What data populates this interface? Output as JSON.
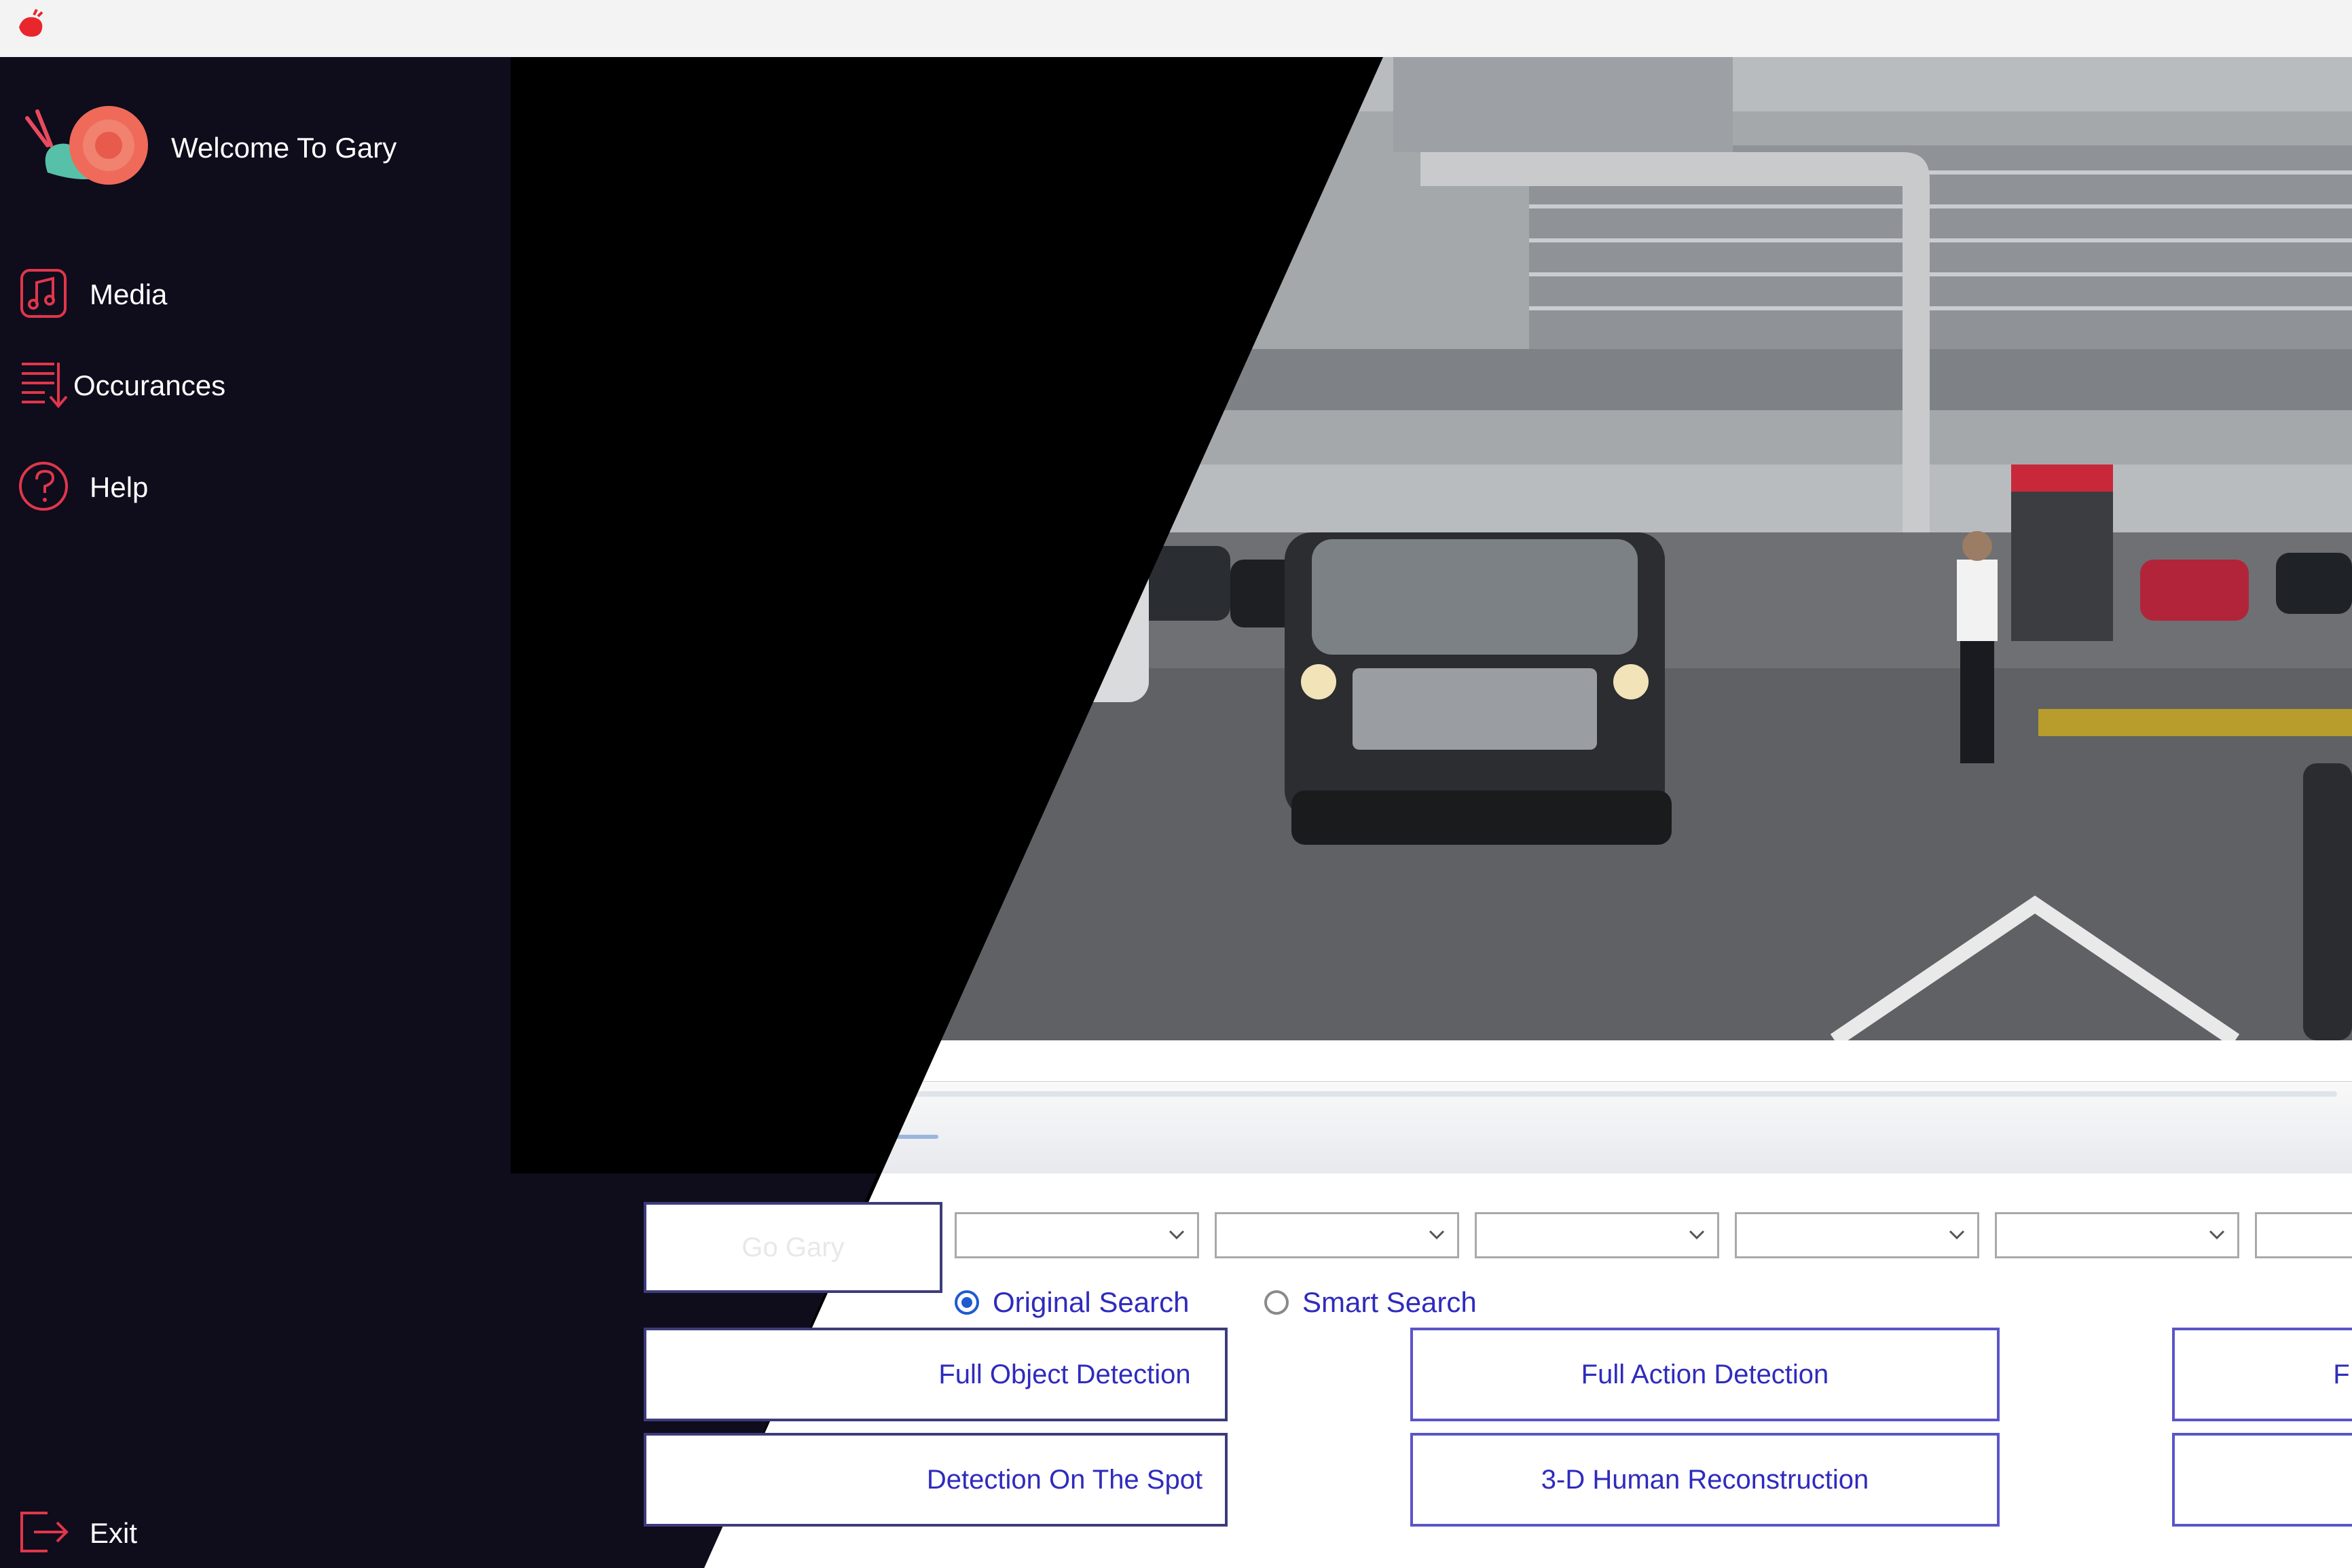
{
  "sidebar": {
    "welcome": "Welcome To Gary",
    "items": [
      {
        "label": "Media",
        "icon": "music-note-icon"
      },
      {
        "label": "Occurances",
        "icon": "list-arrow-icon"
      },
      {
        "label": "Help",
        "icon": "question-icon"
      }
    ],
    "exit": {
      "label": "Exit",
      "icon": "exit-icon"
    }
  },
  "panel": {
    "go_gary": "Go Gary",
    "radios": [
      {
        "label": "Original Search",
        "selected": true
      },
      {
        "label": "Smart Search",
        "selected": false
      }
    ],
    "buttons": [
      "Full Object Detection",
      "Full Action Detection",
      "Detection On The Spot",
      "3-D Human Reconstruction"
    ]
  },
  "colors": {
    "sidebar_bg": "#0f0c1c",
    "accent": "#e94c4c",
    "button_text": "#2f2bbd"
  }
}
